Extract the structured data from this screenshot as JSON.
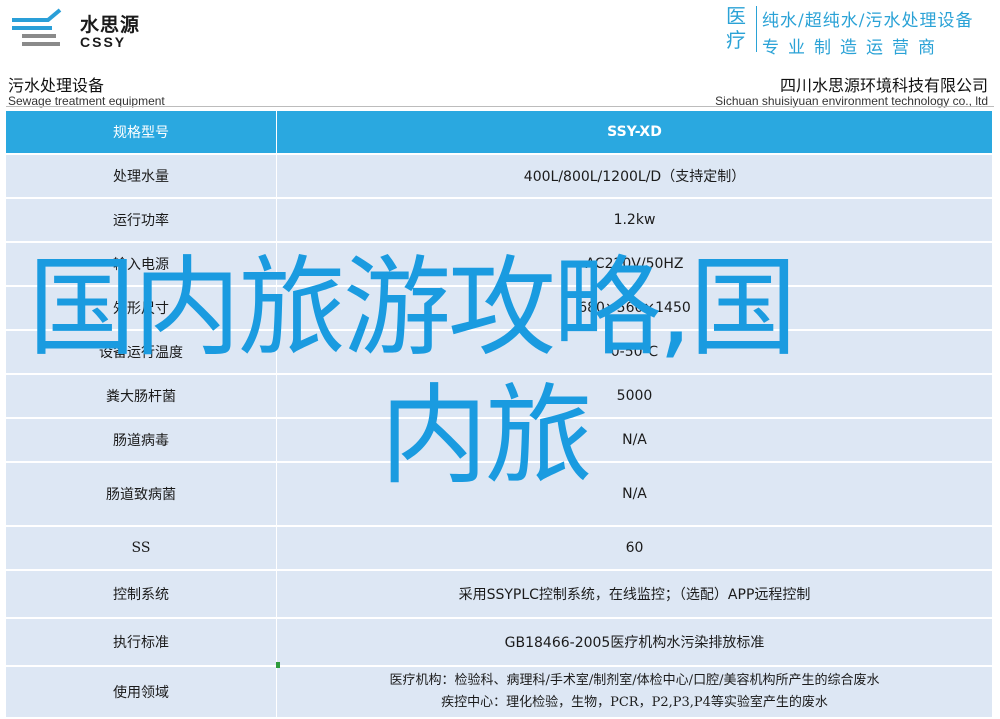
{
  "header": {
    "logo_cn": "水思源",
    "logo_en": "CSSY",
    "badge": "医疗",
    "slogan_line1": "纯水/超纯水/污水处理设备",
    "slogan_line2": "专业制造运营商"
  },
  "subheader": {
    "left_cn": "污水处理设备",
    "left_en": "Sewage treatment equipment",
    "right_cn": "四川水思源环境科技有限公司",
    "right_en": "Sichuan shuisiyuan environment technology co., ltd"
  },
  "table": {
    "rows": [
      {
        "key": "规格型号",
        "value": "SSY-XD"
      },
      {
        "key": "处理水量",
        "value": "400L/800L/1200L/D（支持定制）"
      },
      {
        "key": "运行功率",
        "value": "1.2kw"
      },
      {
        "key": "输入电源",
        "value": "AC220V/50HZ"
      },
      {
        "key": "外形尺寸",
        "value": "680×560×1450"
      },
      {
        "key": "设备运行温度",
        "value": "0-50℃"
      },
      {
        "key": "粪大肠杆菌",
        "value": "5000"
      },
      {
        "key": "肠道病毒",
        "value": "N/A"
      },
      {
        "key": "肠道致病菌",
        "value": "N/A"
      },
      {
        "key": "SS",
        "value": "60"
      },
      {
        "key": "控制系统",
        "value": "采用SSYPLC控制系统，在线监控；（选配）APP远程控制"
      },
      {
        "key": "执行标准",
        "value": "GB18466-2005医疗机构水污染排放标准"
      },
      {
        "key": "使用领域",
        "value_line1": "医疗机构：检验科、病理科/手术室/制剂室/体检中心/口腔/美容机构所产生的综合废水",
        "value_line2": "疾控中心：理化检验，生物，PCR，P2,P3,P4等实验室产生的废水"
      }
    ]
  },
  "overlay": {
    "line1": "国内旅游攻略,国",
    "line2": "内旅"
  },
  "colors": {
    "accent": "#2aa8e0",
    "row_bg": "#dde7f4",
    "overlay_text": "#1a9be0"
  },
  "icons": {
    "logo": "wave-lines-logo-icon"
  }
}
